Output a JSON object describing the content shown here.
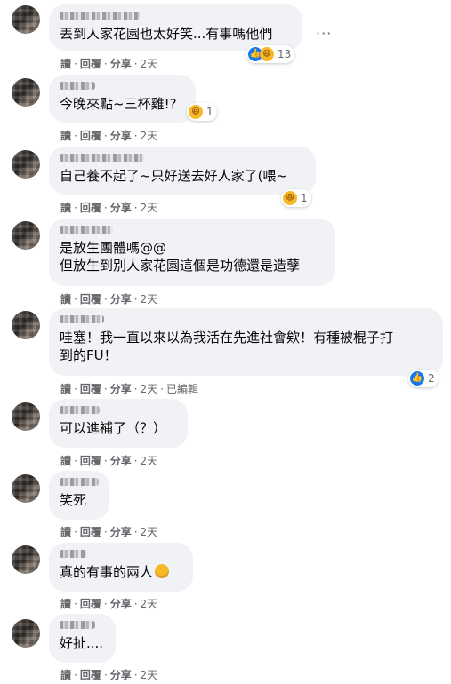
{
  "actions": {
    "read": "讀",
    "reply": "回覆",
    "share": "分享",
    "time": "2天",
    "edited": "已編輯",
    "sep": "·"
  },
  "comments": [
    {
      "text": "丟到人家花園也太好笑...有事嗎他們",
      "reaction_count": "13",
      "reaction_icons": [
        "like-icon",
        "haha-icon"
      ]
    },
    {
      "text": "今晚來點~三杯雞!?",
      "reaction_count": "1",
      "reaction_icons": [
        "haha-icon"
      ]
    },
    {
      "text": "自己養不起了~只好送去好人家了(喂~",
      "reaction_count": "1",
      "reaction_icons": [
        "haha-icon"
      ]
    },
    {
      "text": "是放生團體嗎@@\n但放生到別人家花園這個是功德還是造孽"
    },
    {
      "text": "哇塞！我一直以來以為我活在先進社會欸！有種被棍子打\n到的FU！",
      "reaction_count": "2",
      "reaction_icons": [
        "like-icon"
      ],
      "edited": true
    },
    {
      "text": "可以進補了（？）"
    },
    {
      "text": "笑死"
    },
    {
      "text": "真的有事的兩人",
      "inline_emoji": "sad-emoji"
    },
    {
      "text": "好扯...."
    }
  ],
  "menu_icon": "more-dots-icon",
  "colors": {
    "bubble": "#f0f2f5",
    "meta": "#65676b",
    "like": "#1877f2",
    "haha": "#f7b928"
  }
}
